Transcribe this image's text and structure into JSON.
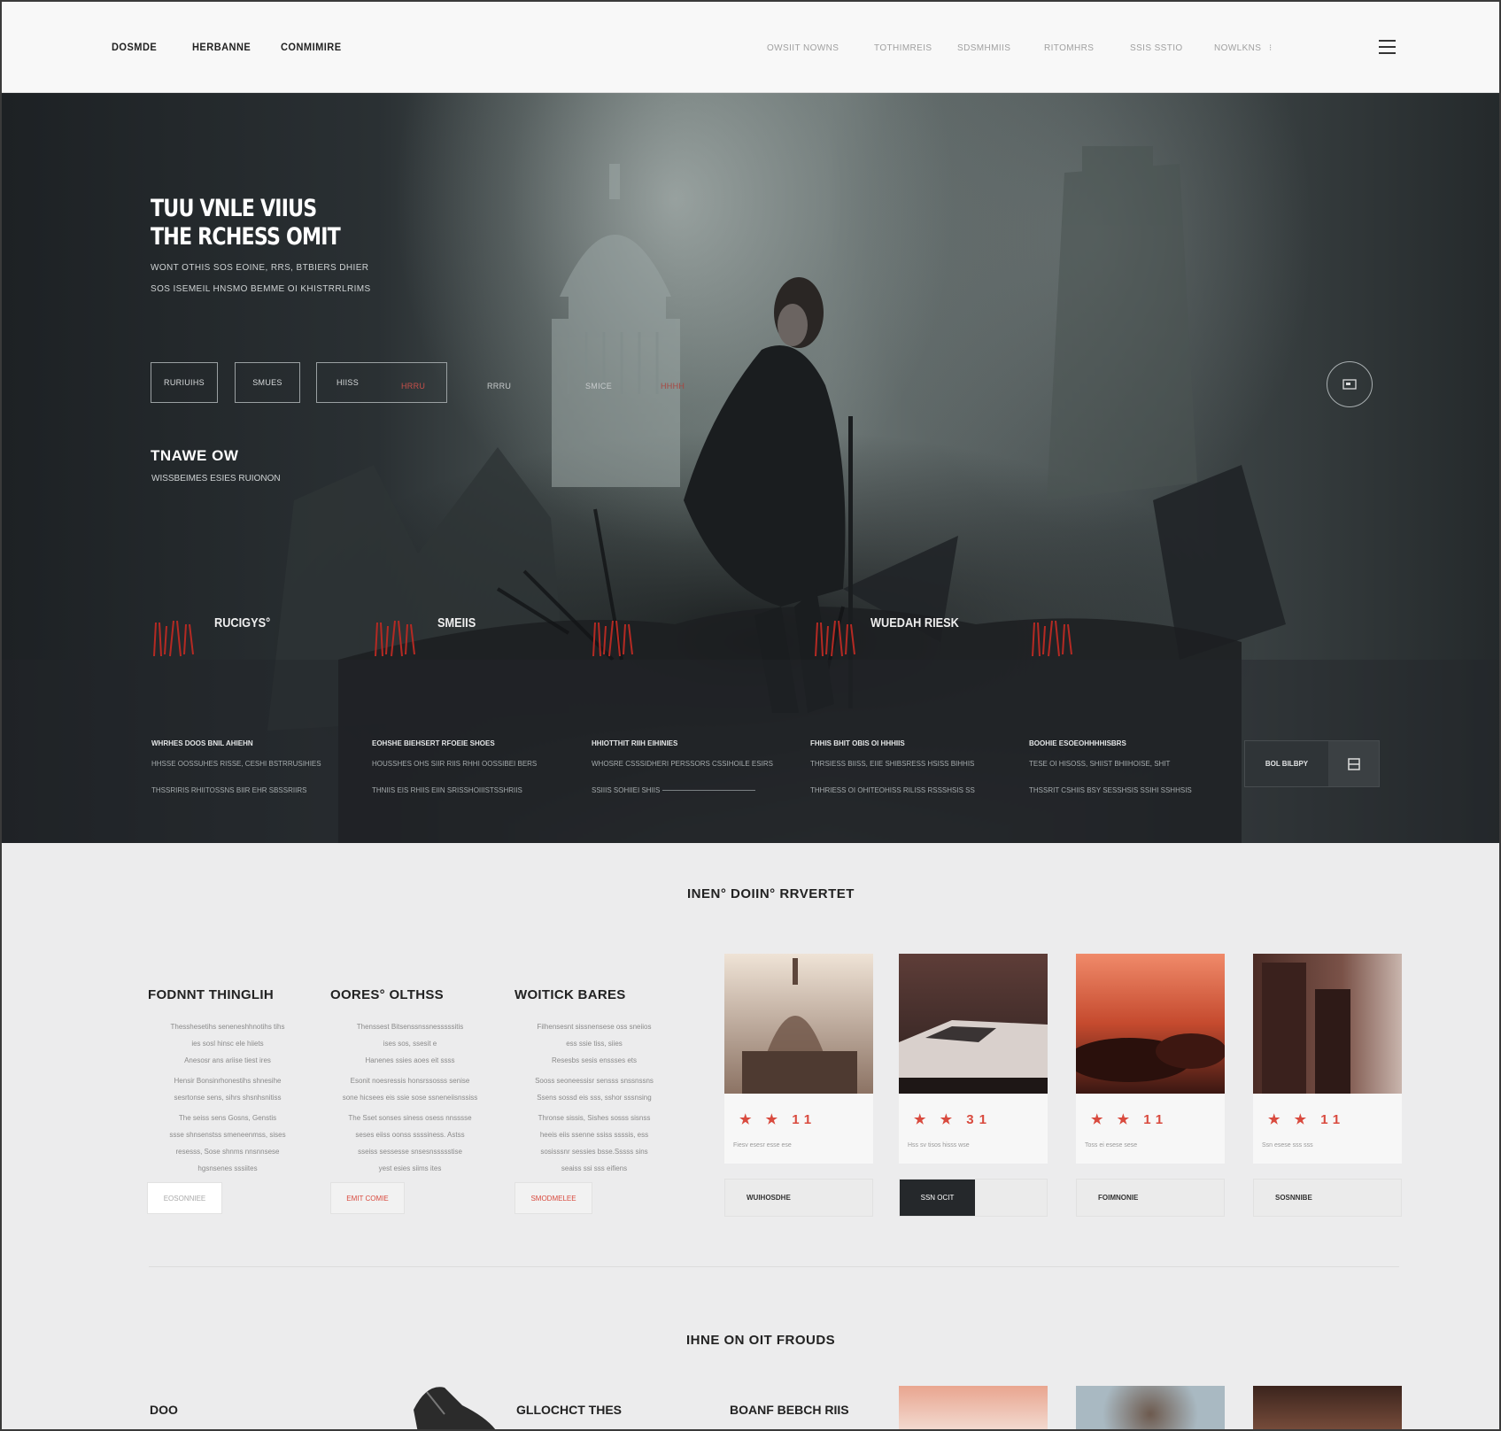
{
  "nav": {
    "left": [
      "DOSMDE",
      "HERBANNE",
      "CONMIMIRE"
    ],
    "right": [
      "OWSIIT NOWNS",
      "TOTHIMREIS",
      "SDSMHMIIS",
      "RITOMHRS",
      "SSIS SSTIO",
      "NOWLKNS"
    ]
  },
  "hero": {
    "title_line1": "TUU VNLE VIIUS",
    "title_line2": "THE RCHESS OMIT",
    "sub_line1": "WONT OTHIS SOS EOINE, RRS, BTBIERS DHIER",
    "sub_line2": "SOS ISEMEIL HNSMO BEMME OI KHISTRRLRIMS",
    "buttons": [
      "RURIUIHS",
      "SMUES",
      "HIISS"
    ],
    "ghost": [
      "HRRU",
      "RRRU",
      "SMICE",
      "HHHH"
    ],
    "section_title": "TNAWE OW",
    "section_sub": "WISSBEIMES ESIES RUIONON",
    "features": [
      "RUCIGYS°",
      "SMEIIS",
      "",
      "WUEDAH RIESK",
      ""
    ],
    "columns": [
      {
        "t": "WHRHES DOOS BNIL AHIEHN",
        "l1": "HHSSE OOSSUHES RISSE, CESHI BSTRRUSIHIES",
        "l2": "THSSRIRIS RHIITOSSNS BIIR EHR SBSSRIIRS"
      },
      {
        "t": "EOHSHE BIEHSERT RFOEIE SHOES",
        "l1": "HOUSSHES OHS SIIR RIIS RHHI OOSSIBEI BERS",
        "l2": "THNIIS EIS RHIIS EIIN SRISSHOIIISTSSHRIIS"
      },
      {
        "t": "HHIOTTHIT RIIH EIHINIES",
        "l1": "WHOSRE CSSSIDHERI PERSSORS CSSIHOILE ESIRS",
        "l2": "SSIIIS SOHIIEI SHIIS"
      },
      {
        "t": "FHHIS BHIT OBIS OI HHHIIS",
        "l1": "THRSIESS BIISS, EIIE SHIBSRESS HSISS BIHHIS",
        "l2": "THHRIESS OI OHITEOHISS RILISS RSSSHSIS SS"
      },
      {
        "t": "BOOHIE ESOEOHHHHISBRS",
        "l1": "TESE OI HISOSS, SHIIST BHIIHOISE, SHIT",
        "l2": "THSSRIT CSHIIS BSY SESSHSIS SSIHI SSHHSIS"
      }
    ],
    "cta_label": "BOL BILBPY"
  },
  "section2": {
    "title": "INEN° DOIIN° RRVERTET",
    "texts": [
      {
        "h": "FODNNT THINGLIH",
        "lines": [
          "Thesshesetihs seneneshhnotihs tihs",
          "ies sosl hinsc ele hiiets",
          "Anesosr ans ariise tiest ires",
          "Hensir Bonsinrhonestihs shnesihe",
          "sesrtonse sens, sihrs shsnhsnitiss",
          "The seiss sens Gosns, Genstis",
          "ssse shnsenstss smeneenmss, sises",
          "resesss, Sose shnms nnsnnsese",
          "hgsnsenes sssiites"
        ],
        "button": "EOSONNIEE"
      },
      {
        "h": "OORES° OLTHSS",
        "lines": [
          "Thenssest Bitsenssnssnesssssitis",
          "ises sos, ssesit e",
          "Hanenes ssies aoes eit ssss",
          "Esonit noesressis honsrssosss senise",
          "sone hicsees eis ssie sose ssneneiisnssiss",
          "The Sset sonses siness osess nnsssse",
          "seses eiiss oonss ssssiness. Astss",
          "sseiss sessesse snsesnssssstise",
          "yest esies siims ites"
        ],
        "button": "EMIT COMIE"
      },
      {
        "h": "WOITICK BARES",
        "lines": [
          "Filhensesnt sissnensese oss sneiios",
          "ess ssie tiss, siies",
          "Resesbs sesis enssses ets",
          "Sooss seoneessisr sensss snssnssns",
          "Ssens sossd eis sss, sshor sssnsing",
          "Thronse sissis, Sishes sosss sisnss",
          "heeis eiis ssenne ssiss ssssis, ess",
          "sosisssnr sessies bsse.Sssss sins",
          "seaiss ssi sss eifiens"
        ],
        "button": "SMODMELEE"
      }
    ],
    "cards": [
      {
        "stars": "★ ★ 11",
        "cap": "Fiesv esesr esse ese",
        "bar": "WUIHOSDHE"
      },
      {
        "stars": "★ ★ 31",
        "cap": "Hss sv tisos hisss wse",
        "bar": "SSN OCIT"
      },
      {
        "stars": "★ ★ 11",
        "cap": "Toss ei esese sese",
        "bar": "FOIMNONIE"
      },
      {
        "stars": "★ ★ 11",
        "cap": "Ssn esese sss sss",
        "bar": "SOSNNIBE"
      }
    ],
    "title2": "IHNE ON OIT FROUDS",
    "bottom": [
      "DOO",
      "GLLOCHCT THES",
      "BOANF BEBCH RIIS"
    ]
  },
  "colors": {
    "accent": "#d94a3e",
    "dark": "#1f2326",
    "panel": "#ececed"
  }
}
